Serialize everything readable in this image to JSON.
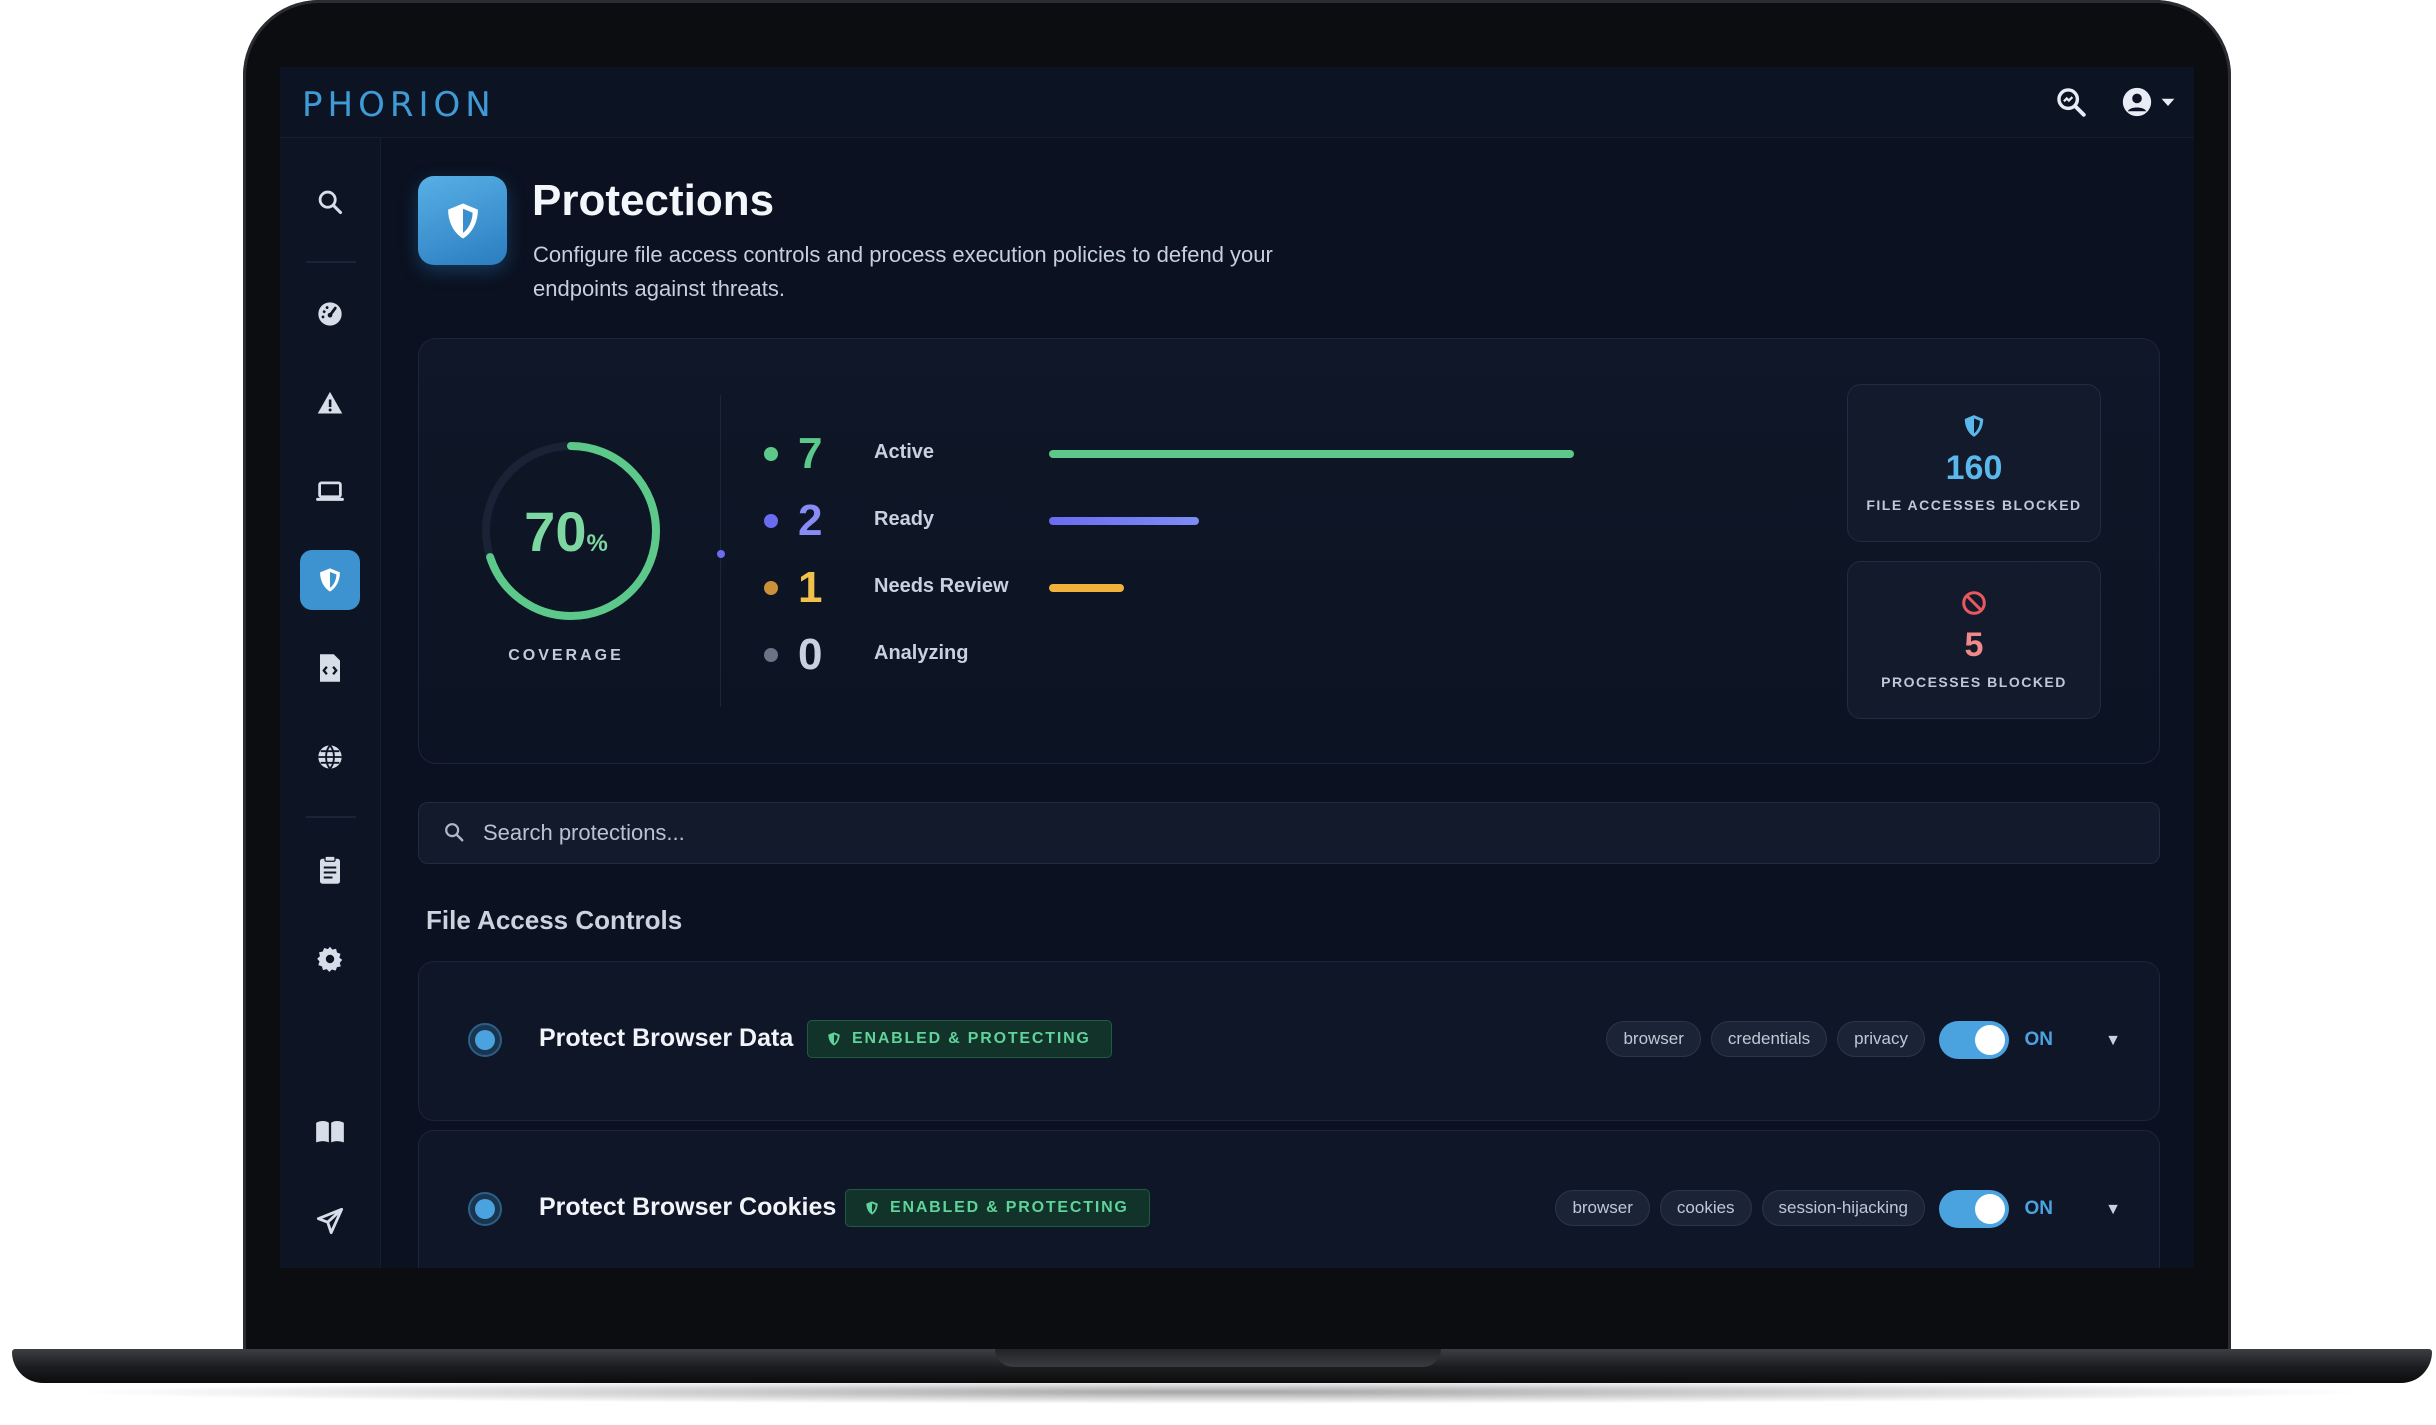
{
  "app": {
    "logo": "PHORION"
  },
  "header": {
    "title": "Protections",
    "subtitle": "Configure file access controls and process execution policies to defend your endpoints against threats."
  },
  "coverage": {
    "percent": "70",
    "percent_sign": "%",
    "label": "COVERAGE",
    "progress_fraction": 0.7
  },
  "stats": [
    {
      "count": "7",
      "label": "Active",
      "color": "#5cc98a",
      "bar_fraction": 1.0
    },
    {
      "count": "2",
      "label": "Ready",
      "color": "#6a6cf0",
      "bar_fraction": 0.286
    },
    {
      "count": "1",
      "label": "Needs Review",
      "color": "#f0b23a",
      "bar_fraction": 0.143
    },
    {
      "count": "0",
      "label": "Analyzing",
      "color": "#7a8496",
      "bar_fraction": 0
    }
  ],
  "blocked": {
    "file_accesses": {
      "value": "160",
      "label": "FILE ACCESSES BLOCKED",
      "color": "#5ab8ea"
    },
    "processes": {
      "value": "5",
      "label": "PROCESSES BLOCKED",
      "color": "#f08a8a"
    }
  },
  "search": {
    "placeholder": "Search protections..."
  },
  "section": {
    "title": "File Access Controls"
  },
  "rules": [
    {
      "title": "Protect Browser Data",
      "status": "ENABLED & PROTECTING",
      "tags": [
        "browser",
        "credentials",
        "privacy"
      ],
      "toggle_label": "ON"
    },
    {
      "title": "Protect Browser Cookies",
      "status": "ENABLED & PROTECTING",
      "tags": [
        "browser",
        "cookies",
        "session-hijacking"
      ],
      "toggle_label": "ON"
    }
  ],
  "colors": {
    "accent": "#4aa3df",
    "success": "#5cc98a",
    "background": "#0b1120"
  }
}
